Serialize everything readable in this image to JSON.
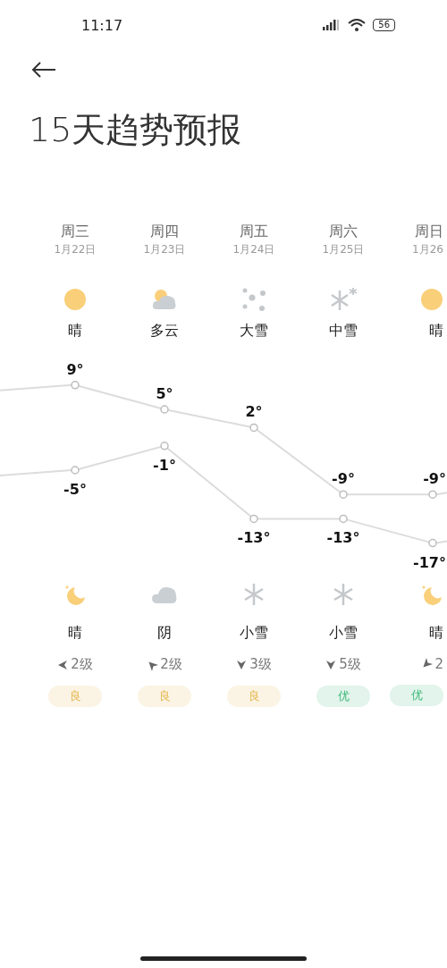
{
  "status_bar": {
    "time": "11:17",
    "battery": "56"
  },
  "title": "15天趋势预报",
  "days": [
    {
      "weekday": "周三",
      "date": "1月22日",
      "day": {
        "kind": "sun",
        "weather": "晴"
      },
      "night": {
        "kind": "moon",
        "weather": "晴"
      },
      "wind": {
        "kind": "left",
        "label": "2级"
      },
      "aqi": {
        "label": "良",
        "color": "#e6b54a"
      }
    },
    {
      "weekday": "周四",
      "date": "1月23日",
      "day": {
        "kind": "partly-cloudy",
        "weather": "多云"
      },
      "night": {
        "kind": "cloud",
        "weather": "阴"
      },
      "wind": {
        "kind": "up-left",
        "label": "2级"
      },
      "aqi": {
        "label": "良",
        "color": "#e6b54a"
      }
    },
    {
      "weekday": "周五",
      "date": "1月24日",
      "day": {
        "kind": "heavy-snow",
        "weather": "大雪"
      },
      "night": {
        "kind": "snow",
        "weather": "小雪"
      },
      "wind": {
        "kind": "down",
        "label": "3级"
      },
      "aqi": {
        "label": "良",
        "color": "#e6b54a"
      }
    },
    {
      "weekday": "周六",
      "date": "1月25日",
      "day": {
        "kind": "snow",
        "weather": "中雪"
      },
      "night": {
        "kind": "snow",
        "weather": "小雪"
      },
      "wind": {
        "kind": "down",
        "label": "5级"
      },
      "aqi": {
        "label": "优",
        "color": "#3cb878"
      }
    },
    {
      "weekday": "周日",
      "date": "1月26",
      "day": {
        "kind": "sun",
        "weather": "晴"
      },
      "night": {
        "kind": "moon",
        "weather": "晴"
      },
      "wind": {
        "kind": "down-left",
        "label": "2"
      },
      "aqi": {
        "label": "优",
        "color": "#3cb878"
      }
    }
  ],
  "chart_data": {
    "type": "line",
    "series": [
      {
        "color": "#dcdcdc",
        "marker": "circle",
        "values": [
          9,
          5,
          2,
          -9,
          -9
        ],
        "value_labels": [
          "9°",
          "5°",
          "2°",
          "-9°",
          "-9°"
        ]
      },
      {
        "color": "#dcdcdc",
        "marker": "circle",
        "values": [
          -5,
          -1,
          -13,
          -13,
          -17
        ],
        "value_labels": [
          "-5°",
          "-1°",
          "-13°",
          "-13°",
          "-17°"
        ]
      }
    ]
  }
}
